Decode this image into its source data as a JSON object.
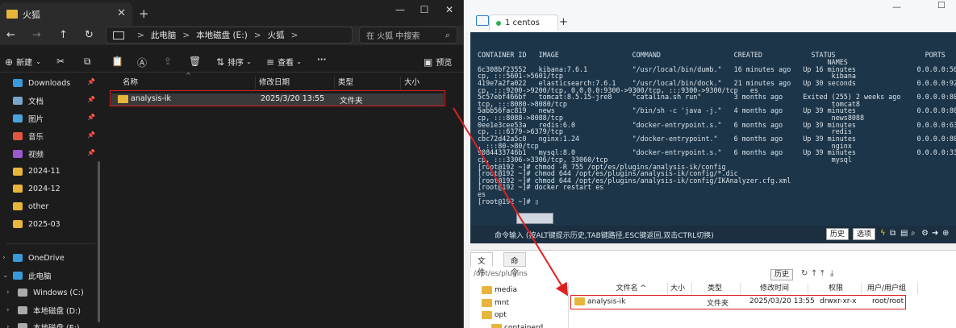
{
  "explorer": {
    "tab_title": "火狐",
    "tab_close": "✕",
    "new_tab": "+",
    "window_controls": {
      "minimize": "—",
      "maximize": "☐",
      "close": "✕"
    },
    "nav_icons": {
      "back": "←",
      "forward": "→",
      "up": "↑",
      "refresh": "↻"
    },
    "breadcrumb": [
      "此电脑",
      "本地磁盘 (E:)",
      "火狐"
    ],
    "breadcrumb_sep": ">",
    "search_placeholder": "在 火狐 中搜索",
    "toolbar": {
      "new_label": "新建",
      "sort_label": "排序",
      "view_label": "查看",
      "more_label": "···",
      "preview_label": "预览"
    },
    "sidebar": {
      "quick": [
        {
          "label": "Downloads",
          "icon": "download-icon",
          "color": "#3a9ad9",
          "pinned": true
        },
        {
          "label": "文档",
          "icon": "document-icon",
          "color": "#7aa6c9",
          "pinned": true
        },
        {
          "label": "图片",
          "icon": "picture-icon",
          "color": "#4aa3df",
          "pinned": true
        },
        {
          "label": "音乐",
          "icon": "music-icon",
          "color": "#e0563f",
          "pinned": true
        },
        {
          "label": "视频",
          "icon": "video-icon",
          "color": "#9b59d0",
          "pinned": true
        },
        {
          "label": "2024-11",
          "icon": "folder-icon",
          "color": "#e8b53b",
          "pinned": false
        },
        {
          "label": "2024-12",
          "icon": "folder-icon",
          "color": "#e8b53b",
          "pinned": false
        },
        {
          "label": "other",
          "icon": "folder-icon",
          "color": "#e8b53b",
          "pinned": false
        },
        {
          "label": "2025-03",
          "icon": "folder-icon",
          "color": "#e8b53b",
          "pinned": false
        }
      ],
      "pin_glyph": "📌",
      "tree": [
        {
          "label": "OneDrive",
          "icon": "cloud-icon",
          "color": "#3a9ad9"
        },
        {
          "label": "此电脑",
          "icon": "computer-icon",
          "color": "#3a9ad9"
        },
        {
          "label": "Windows (C:)",
          "icon": "drive-icon",
          "color": "#aaaaaa"
        },
        {
          "label": "本地磁盘 (D:)",
          "icon": "drive-icon",
          "color": "#aaaaaa"
        },
        {
          "label": "本地磁盘 (E:)",
          "icon": "drive-icon",
          "color": "#aaaaaa"
        }
      ]
    },
    "columns": [
      "名称",
      "修改日期",
      "类型",
      "大小"
    ],
    "files": [
      {
        "name": "analysis-ik",
        "modified": "2025/3/20 13:55",
        "type": "文件夹",
        "size": ""
      }
    ]
  },
  "xshell": {
    "tab_label": "1 centos",
    "add_tab": "+",
    "terminal_lines": [
      "CONTAINER ID   IMAGE                  COMMAND                  CREATED            STATUS                      PORTS",
      "                                                                                      NAMES",
      "6c308bf23552   kibana:7.6.1           \"/usr/local/bin/dumb.\"   16 minutes ago   Up 16 minutes               0.0.0.0:5601->5601/t",
      "cp, :::5601->5601/tcp                                                                  kibana",
      "419e7a2fa022   elasticsearch:7.6.1    \"/usr/local/bin/dock.\"   21 minutes ago   Up 30 seconds               0.0.0.0:9200->9200/t",
      "cp, :::9200->9200/tcp, 0.0.0.0:9300->9300/tcp, :::9300->9300/tcp   es",
      "5c57ebf466bf   tomcat:8.5.15-jre8     \"catalina.sh run\"        3 months ago     Exited (255) 2 weeks ago    0.0.0.0:8080->8080/",
      "tcp, :::8080->8080/tcp                                                                 tomcat8",
      "5abb56fac819   news                   \"/bin/sh -c 'java -j.\"   4 months ago     Up 39 minutes               0.0.0.0:8088->8088/t",
      "cp, :::8088->8088/tcp                                                                  news8088",
      "0ee1e3cee53a   redis:6.0              \"docker-entrypoint.s.\"   6 months ago     Up 39 minutes               0.0.0.0:6379->6379/t",
      "cp, :::6379->6379/tcp                                                                  redis",
      "cbc72d42a5c0   nginx:1.24             \"/docker-entrypoint.\"    6 months ago     Up 39 minutes               0.0.0.0:80->80/tcp",
      ", :::80->80/tcp                                                                        nginx",
      "9084433746b1   mysql:8.0              \"docker-entrypoint.s.\"   6 months ago     Up 39 minutes               0.0.0.0:3306->3306/t",
      "cp, :::3306->3306/tcp, 33060/tcp                                                       mysql",
      "[root@192 ~]# chmod -R 755 /opt/es/plugins/analysis-ik/config",
      "[root@192 ~]# chmod 644 /opt/es/plugins/analysis-ik/config/*.dic",
      "[root@192 ~]# chmod 644 /opt/es/plugins/analysis-ik/config/IKAnalyzer.cfg.xml",
      "[root@192 ~]# docker restart es",
      "es",
      "[root@192 ~]# ▯"
    ],
    "cmdbar": {
      "text": "命令输入 (按ALT键提示历史,TAB键路径,ESC键返回,双击CTRL切换)",
      "history_btn": "历史",
      "options_btn": "选项"
    },
    "sftp": {
      "tabs": [
        "文件",
        "命令"
      ],
      "path": "/opt/es/plugins",
      "history_btn": "历史",
      "tree": [
        "media",
        "mnt",
        "opt",
        "containerd"
      ],
      "columns": [
        "文件名 ^",
        "大小",
        "类型",
        "修改时间",
        "权限",
        "用户/用户组"
      ],
      "files": [
        {
          "name": "analysis-ik",
          "size": "",
          "type": "文件夹",
          "modified": "2025/03/20 13:55",
          "perm": "drwxr-xr-x",
          "owner": "root/root"
        }
      ]
    }
  },
  "annotation": {
    "color": "#e02020"
  }
}
